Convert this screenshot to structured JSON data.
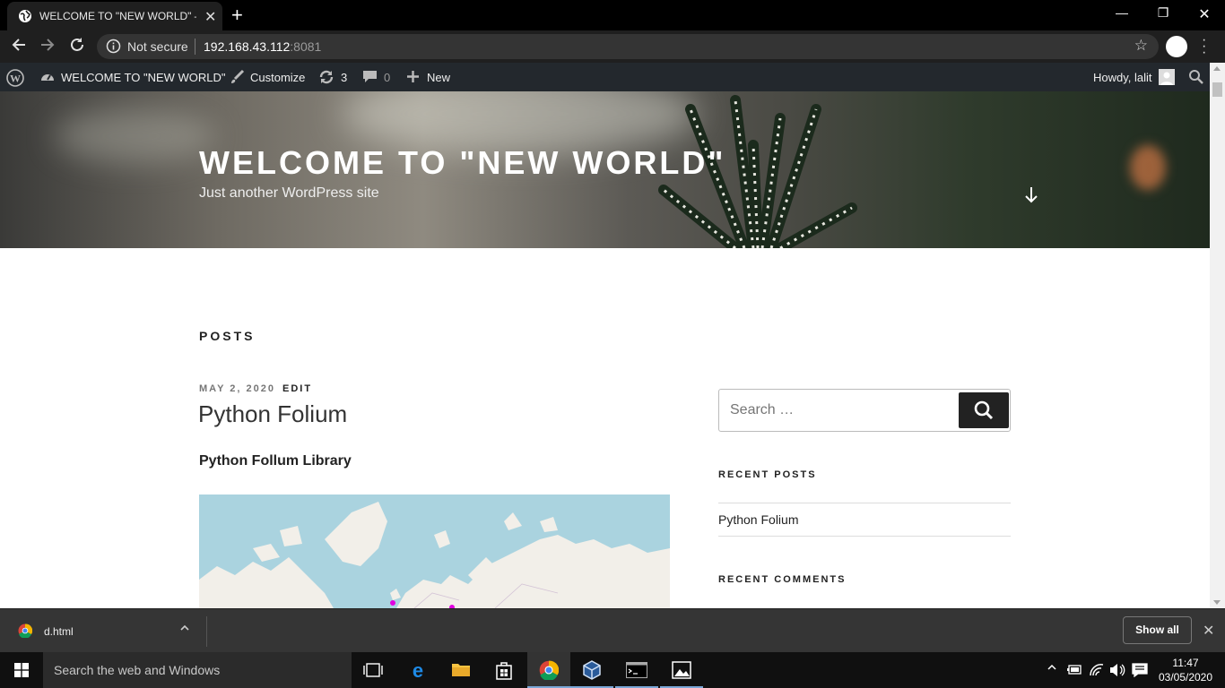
{
  "browser": {
    "tab_title": "WELCOME TO \"NEW WORLD\" – J",
    "security_label": "Not secure",
    "url_host": "192.168.43.112",
    "url_port": ":8081"
  },
  "adminbar": {
    "site_name": "WELCOME TO \"NEW WORLD\"",
    "customize": "Customize",
    "updates_count": "3",
    "comments_count": "0",
    "new_label": "New",
    "howdy": "Howdy, lalit"
  },
  "header": {
    "site_title": "WELCOME TO \"NEW WORLD\"",
    "site_description": "Just another WordPress site"
  },
  "content": {
    "section_heading": "POSTS",
    "post_date": "MAY 2, 2020",
    "post_edit": "EDIT",
    "post_title": "Python Folium",
    "post_subtitle": "Python Follum Library"
  },
  "sidebar": {
    "search_placeholder": "Search …",
    "recent_posts_heading": "RECENT POSTS",
    "recent_posts": [
      "Python Folium"
    ],
    "recent_comments_heading": "RECENT COMMENTS"
  },
  "downloads": {
    "file_name": "d.html",
    "show_all": "Show all"
  },
  "taskbar": {
    "search_placeholder": "Search the web and Windows",
    "time": "11:47",
    "date": "03/05/2020"
  },
  "colors": {
    "adminbar_bg": "#23282d",
    "browser_bg": "#000000",
    "map_water": "#aad3df",
    "map_land": "#f2efe9"
  }
}
